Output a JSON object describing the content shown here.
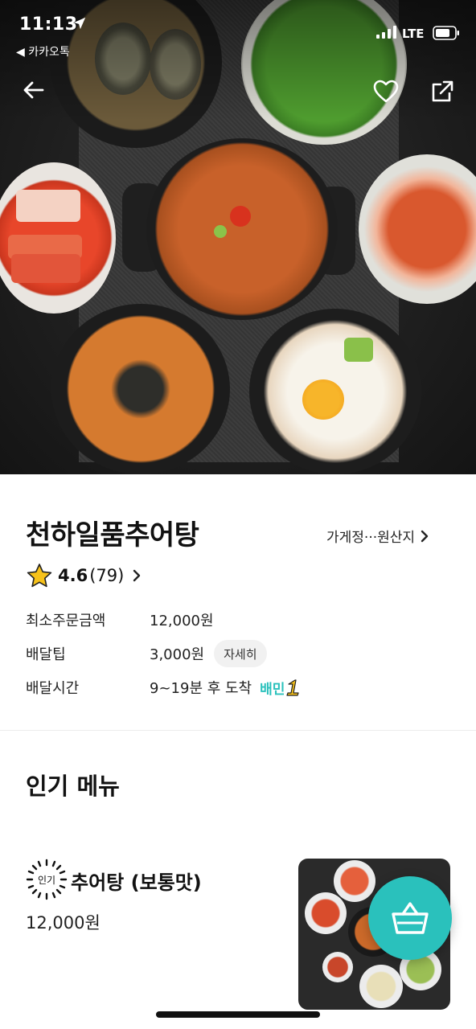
{
  "status_bar": {
    "time": "11:13",
    "back_app": "◀ 카카오톡",
    "network": "LTE"
  },
  "hero": {
    "image_icon": "food-photo",
    "actions": [
      "back-arrow-icon",
      "heart-icon",
      "share-icon"
    ]
  },
  "store": {
    "name": "천하일품추어탕",
    "info_link": "가게정···원산지",
    "rating": "4.6",
    "review_count": "(79)"
  },
  "info": {
    "min_order_label": "최소주문금액",
    "min_order_value": "12,000원",
    "delivery_tip_label": "배달팁",
    "delivery_tip_value": "3,000원",
    "detail_button": "자세히",
    "delivery_time_label": "배달시간",
    "delivery_time_value": "9~19분 후 도착",
    "baemin_badge": "배민"
  },
  "popular": {
    "section_title": "인기 메뉴",
    "badge": "인기",
    "items": [
      {
        "name": "추어탕 (보통맛)",
        "price": "12,000원"
      }
    ]
  },
  "colors": {
    "accent": "#2ac1bc",
    "star": "#f7c21a"
  }
}
